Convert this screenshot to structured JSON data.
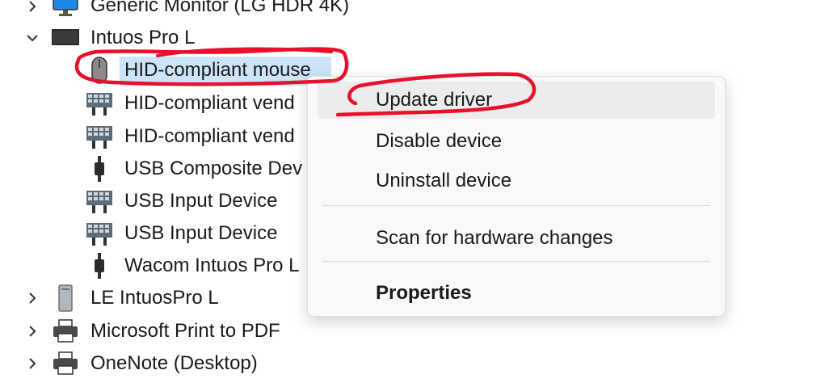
{
  "device_tree": {
    "items": [
      {
        "label": "Generic Monitor (LG HDR 4K)",
        "icon": "monitor-icon",
        "expander": "chevron-right"
      },
      {
        "label": "Intuos Pro L",
        "icon": "tablet-device-icon",
        "expander": "chevron-down"
      },
      {
        "label": "HID-compliant mouse",
        "icon": "mouse-icon"
      },
      {
        "label": "HID-compliant vend",
        "icon": "keyboard-device-icon"
      },
      {
        "label": "HID-compliant vend",
        "icon": "keyboard-device-icon"
      },
      {
        "label": "USB Composite Dev",
        "icon": "usb-plug-icon"
      },
      {
        "label": "USB Input Device",
        "icon": "keyboard-device-icon"
      },
      {
        "label": "USB Input Device",
        "icon": "keyboard-device-icon"
      },
      {
        "label": "Wacom Intuos Pro L",
        "icon": "usb-plug-icon"
      },
      {
        "label": "LE IntuosPro L",
        "icon": "tower-pc-icon",
        "expander": "chevron-right"
      },
      {
        "label": "Microsoft Print to PDF",
        "icon": "printer-icon",
        "expander": "chevron-right"
      },
      {
        "label": "OneNote (Desktop)",
        "icon": "printer-icon",
        "expander": "chevron-right"
      }
    ]
  },
  "context_menu": {
    "items": [
      {
        "label": "Update driver",
        "state": "hover"
      },
      {
        "label": "Disable device"
      },
      {
        "label": "Uninstall device"
      },
      {
        "label": "Scan for hardware changes"
      },
      {
        "label": "Properties",
        "bold": true
      }
    ]
  },
  "colors": {
    "selection": "#cce4f7",
    "annotation": "#e8102a",
    "menu_bg": "#f9f9f9",
    "menu_hover": "#ececec"
  }
}
